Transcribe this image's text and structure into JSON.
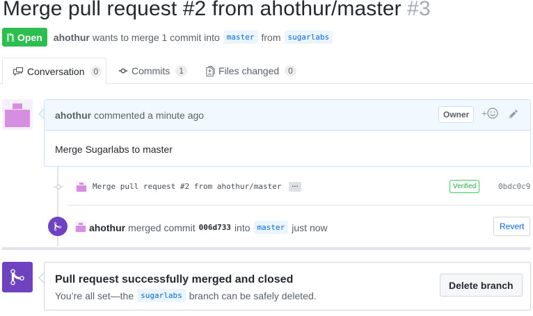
{
  "pr": {
    "title": "Merge pull request #2 from ahothur/master",
    "number": "#3",
    "state": "Open",
    "author": "ahothur",
    "merge_text_1": "wants to merge 1 commit into",
    "base_branch": "master",
    "merge_text_2": "from",
    "head_branch": "sugarlabs"
  },
  "tabs": [
    {
      "label": "Conversation",
      "count": "0",
      "icon": "comment-discussion-icon"
    },
    {
      "label": "Commits",
      "count": "1",
      "icon": "git-commit-icon"
    },
    {
      "label": "Files changed",
      "count": "0",
      "icon": "diff-icon"
    }
  ],
  "comment": {
    "author": "ahothur",
    "action": "commented a minute ago",
    "role_badge": "Owner",
    "reaction_plus": "+",
    "body": "Merge Sugarlabs to master"
  },
  "commit": {
    "message": "Merge pull request #2 from ahothur/master",
    "ellipsis": "…",
    "verified": "Verified",
    "sha": "0bdc0c9"
  },
  "merged_event": {
    "author": "ahothur",
    "action": "merged commit",
    "sha": "006d733",
    "into": "into",
    "branch": "master",
    "when": "just now",
    "revert_label": "Revert"
  },
  "merge_status": {
    "title": "Pull request successfully merged and closed",
    "sub_before": "You’re all set—the",
    "branch": "sugarlabs",
    "sub_after": "branch can be safely deleted.",
    "delete_label": "Delete branch"
  },
  "colors": {
    "open_green": "#2cbe4e",
    "merged_purple": "#6f42c1",
    "link_blue": "#0366d6",
    "avatar_pink": "#d58ee0"
  }
}
